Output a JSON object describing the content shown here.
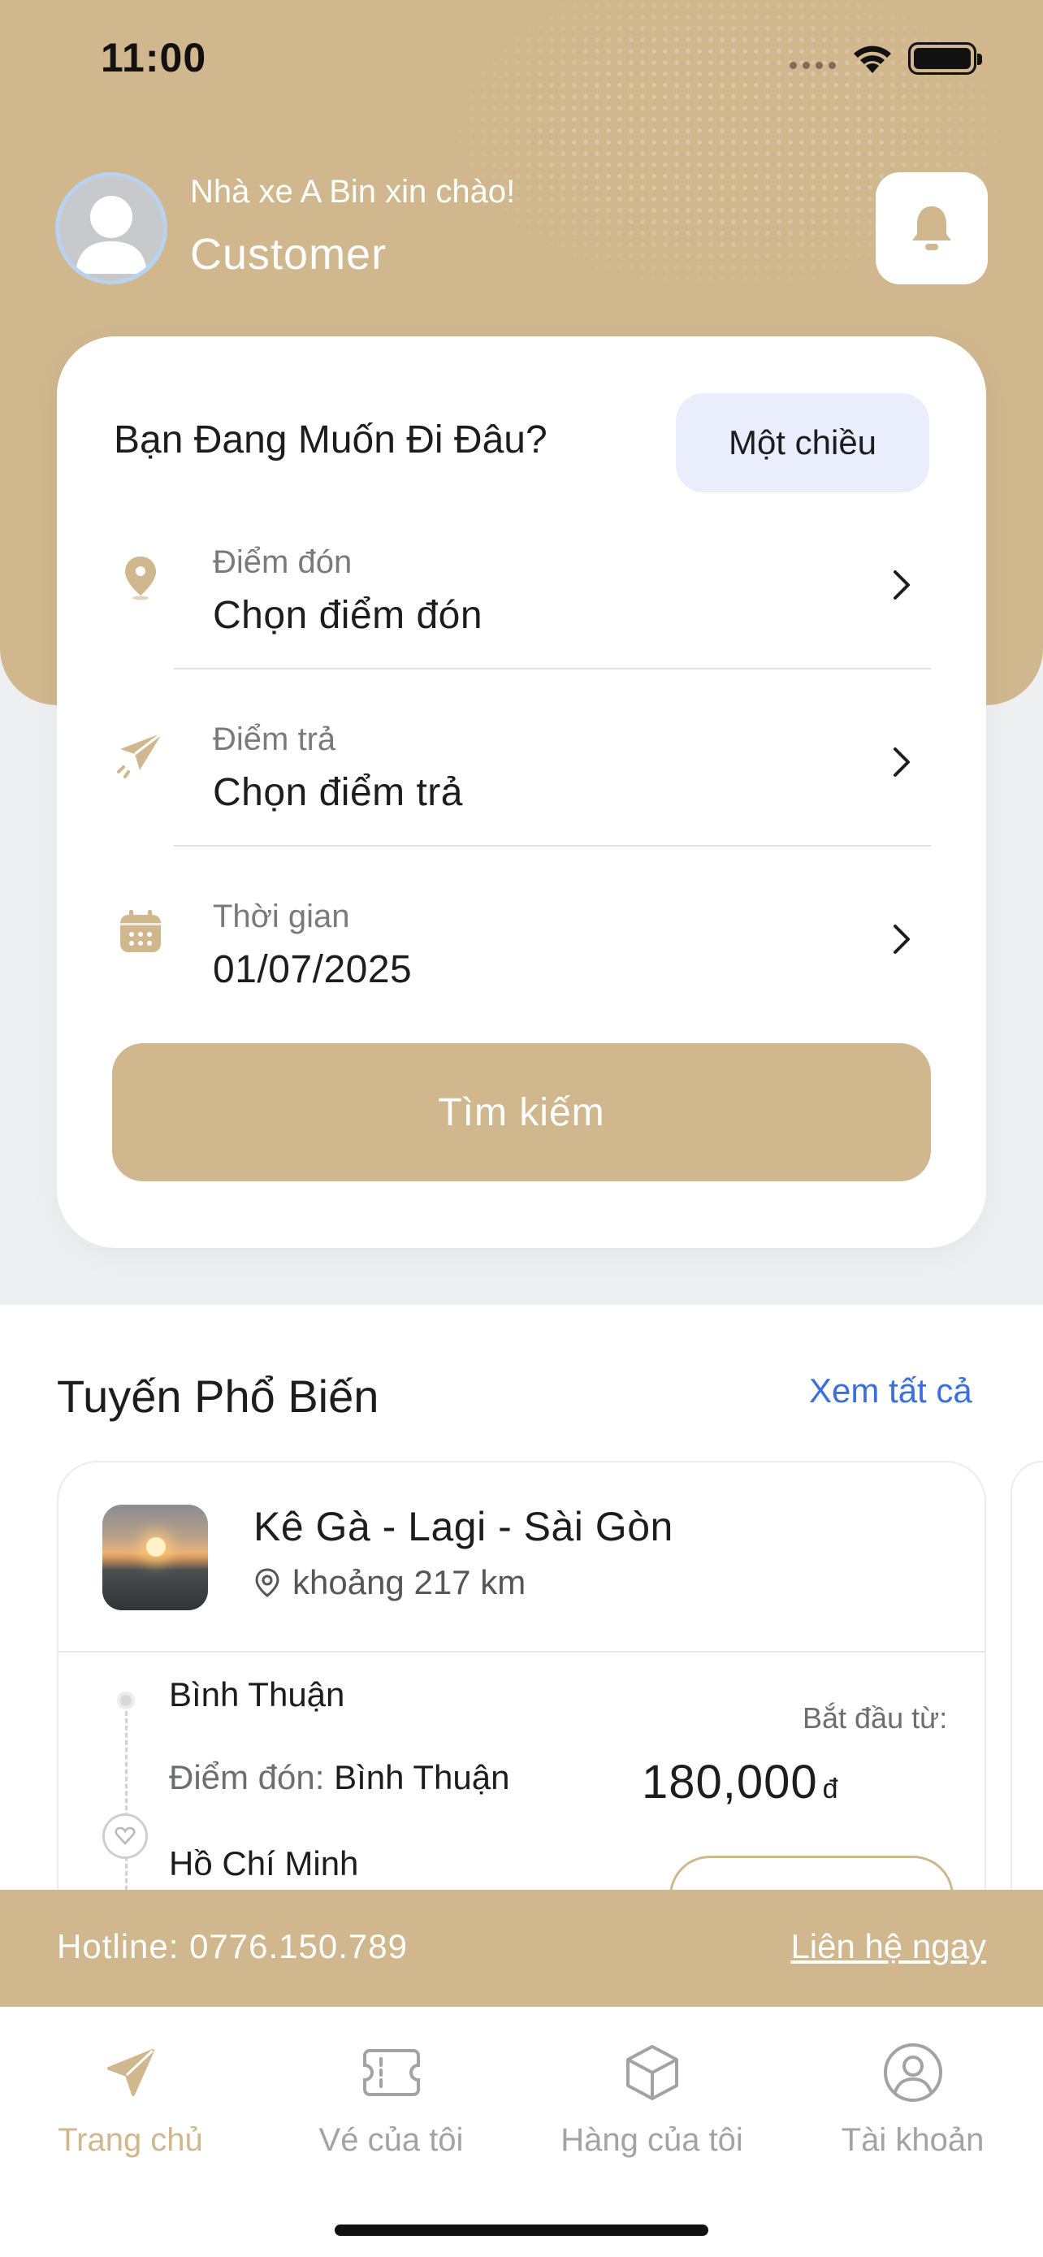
{
  "status_bar": {
    "time": "11:00"
  },
  "header": {
    "greeting": "Nhà xe A Bin xin chào!",
    "user_name": "Customer"
  },
  "search_card": {
    "title": "Bạn Đang Muốn Đi Đâu?",
    "trip_type": "Một chiều",
    "pickup": {
      "label": "Điểm đón",
      "value": "Chọn điểm đón"
    },
    "dropoff": {
      "label": "Điểm trả",
      "value": "Chọn điểm trả"
    },
    "date": {
      "label": "Thời gian",
      "value": "01/07/2025"
    },
    "search_button": "Tìm kiếm"
  },
  "popular_routes": {
    "title": "Tuyến Phổ Biến",
    "see_all": "Xem tất cả",
    "routes": [
      {
        "name": "Kê Gà - Lagi - Sài Gòn",
        "distance": "khoảng 217 km",
        "from": "Bình Thuận",
        "pickup_label": "Điểm đón:",
        "pickup_value": "Bình Thuận",
        "to": "Hồ Chí Minh",
        "start_from_label": "Bắt đầu từ:",
        "price": "180,000",
        "currency": "đ"
      }
    ]
  },
  "hotline": {
    "text": "Hotline: 0776.150.789",
    "contact_link": "Liên hệ ngay"
  },
  "tabs": [
    {
      "label": "Trang chủ",
      "icon": "paper-plane-icon",
      "active": true
    },
    {
      "label": "Vé của tôi",
      "icon": "ticket-icon",
      "active": false
    },
    {
      "label": "Hàng của tôi",
      "icon": "package-icon",
      "active": false
    },
    {
      "label": "Tài khoản",
      "icon": "user-circle-icon",
      "active": false
    }
  ],
  "colors": {
    "accent": "#d1b78e",
    "link": "#3a6fdc",
    "trip_type_bg": "#eaedfb",
    "inactive_tab": "#a3a3a6"
  }
}
